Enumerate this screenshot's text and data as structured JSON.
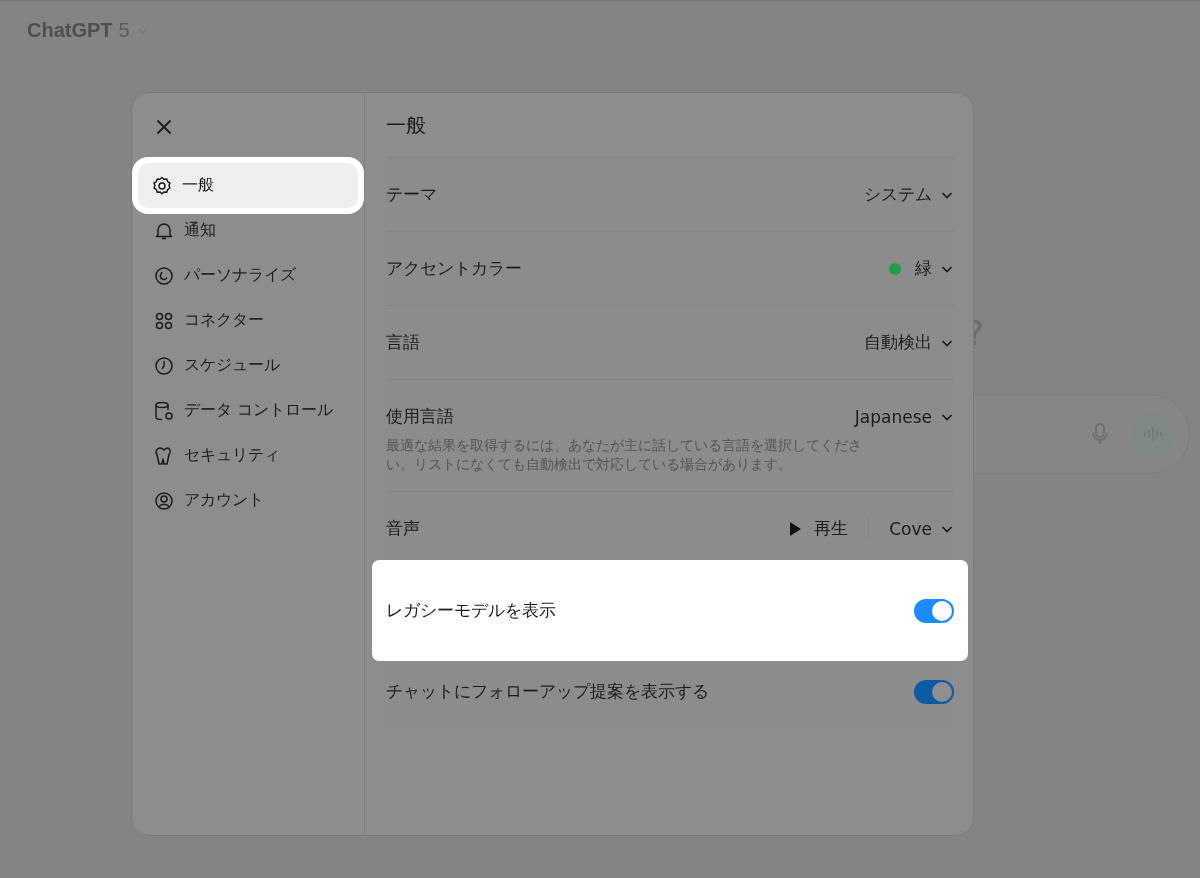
{
  "background": {
    "model_name": "ChatGPT",
    "model_version": "5",
    "heading_fragment": "?"
  },
  "dialog": {
    "sidebar": [
      {
        "label": "一般",
        "selected": true
      },
      {
        "label": "通知",
        "selected": false
      },
      {
        "label": "パーソナライズ",
        "selected": false
      },
      {
        "label": "コネクター",
        "selected": false
      },
      {
        "label": "スケジュール",
        "selected": false
      },
      {
        "label": "データ コントロール",
        "selected": false
      },
      {
        "label": "セキュリティ",
        "selected": false
      },
      {
        "label": "アカウント",
        "selected": false
      }
    ],
    "title": "一般",
    "settings": [
      {
        "kind": "select",
        "label": "テーマ",
        "value": "システム",
        "highlighted": false
      },
      {
        "kind": "select",
        "label": "アクセントカラー",
        "value": "緑",
        "color": "#1f9d48",
        "highlighted": false
      },
      {
        "kind": "select",
        "label": "言語",
        "value": "自動検出",
        "highlighted": false
      },
      {
        "kind": "select",
        "label": "使用言語",
        "value": "Japanese",
        "description": "最適な結果を取得するには、あなたが主に話している言語を選択してください。リストになくても自動検出で対応している場合があります。",
        "highlighted": false
      },
      {
        "kind": "voice",
        "label": "音声",
        "play_label": "再生",
        "value": "Cove",
        "highlighted": false
      },
      {
        "kind": "toggle",
        "label": "レガシーモデルを表示",
        "on": true,
        "highlighted": true
      },
      {
        "kind": "toggle",
        "label": "チャットにフォローアップ提案を表示する",
        "on": true,
        "highlighted": false
      }
    ]
  }
}
